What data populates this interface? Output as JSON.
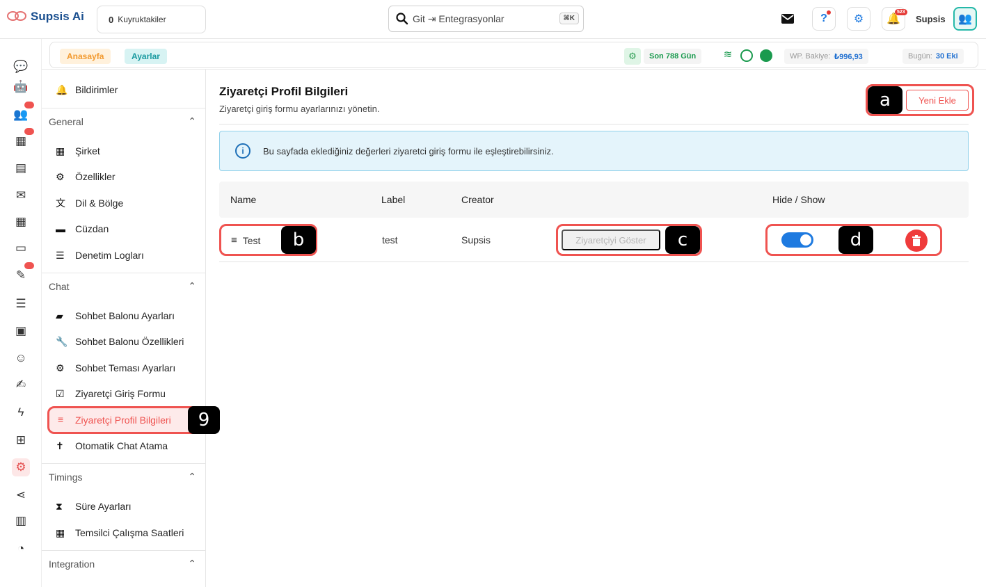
{
  "app": {
    "logo_text": "Supsis Ai"
  },
  "topbar": {
    "queue_count": "0",
    "queue_label": "Kuyruktakiler",
    "search_icon": "search-icon",
    "search_text": "Git ⇥ Entegrasyonlar",
    "search_shortcut": "⌘K",
    "notification_count": "523",
    "user_name": "Supsis"
  },
  "breadcrumb": {
    "home": "Anasayfa",
    "settings": "Ayarlar",
    "days_label": "Son 788 Gün",
    "wp_balance_label": "WP. Bakiye:",
    "wp_balance_value": "₺996,93",
    "today_label": "Bugün:",
    "today_value": "30 Eki"
  },
  "sidebar": {
    "top_item": "Bildirimler",
    "sections": [
      {
        "title": "General",
        "items": [
          "Şirket",
          "Özellikler",
          "Dil & Bölge",
          "Cüzdan",
          "Denetim Logları"
        ]
      },
      {
        "title": "Chat",
        "items": [
          "Sohbet Balonu Ayarları",
          "Sohbet Balonu Özellikleri",
          "Sohbet Teması Ayarları",
          "Ziyaretçi Giriş Formu",
          "Ziyaretçi Profil Bilgileri",
          "Otomatik Chat Atama"
        ]
      },
      {
        "title": "Timings",
        "items": [
          "Süre Ayarları",
          "Temsilci Çalışma Saatleri"
        ]
      },
      {
        "title": "Integration",
        "items": []
      }
    ],
    "active_item": "Ziyaretçi Profil Bilgileri"
  },
  "markers": {
    "sidebar": "9",
    "add": "a",
    "name": "b",
    "show": "c",
    "actions": "d"
  },
  "main": {
    "title": "Ziyaretçi Profil Bilgileri",
    "subtitle": "Ziyaretçi giriş formu ayarlarınızı yönetin.",
    "add_button": "Yeni Ekle",
    "info_text": "Bu sayfada eklediğiniz değerleri ziyaretci giriş formu ile eşleştirebilirsiniz.",
    "table": {
      "headers": [
        "Name",
        "Label",
        "Creator",
        "Hide / Show"
      ],
      "rows": [
        {
          "name": "Test",
          "label": "test",
          "creator": "Supsis",
          "show_button": "Ziyaretçiyi Göster",
          "visible": true
        }
      ]
    }
  },
  "colors": {
    "accent": "#ef5350",
    "brand": "#1a4f8f",
    "toggle": "#1e7ae0",
    "info_bg": "#e4f4fb"
  }
}
